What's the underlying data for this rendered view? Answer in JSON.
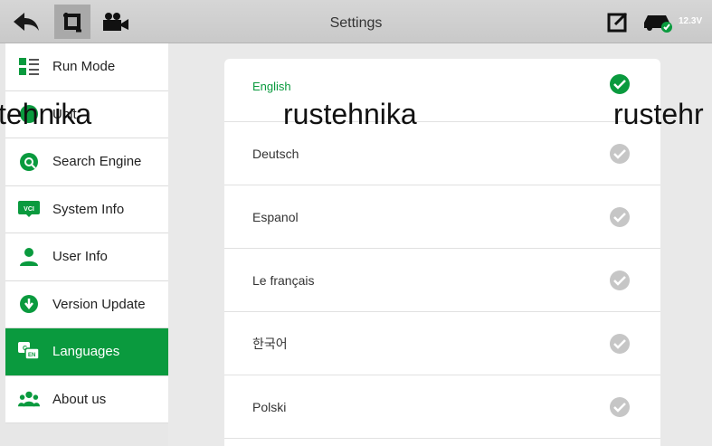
{
  "topbar": {
    "title": "Settings",
    "voltage": "12.3V"
  },
  "sidebar": {
    "items": [
      {
        "label": "Run Mode",
        "icon": "list-icon",
        "active": false
      },
      {
        "label": "Unit",
        "icon": "unit-icon",
        "active": false
      },
      {
        "label": "Search Engine",
        "icon": "search-engine-icon",
        "active": false
      },
      {
        "label": "System Info",
        "icon": "vci-icon",
        "active": false
      },
      {
        "label": "User Info",
        "icon": "user-icon",
        "active": false
      },
      {
        "label": "Version Update",
        "icon": "download-icon",
        "active": false
      },
      {
        "label": "Languages",
        "icon": "languages-icon",
        "active": true
      },
      {
        "label": "About us",
        "icon": "people-icon",
        "active": false
      }
    ]
  },
  "languages": {
    "items": [
      {
        "label": "English",
        "selected": true
      },
      {
        "label": "Deutsch",
        "selected": false
      },
      {
        "label": "Espanol",
        "selected": false
      },
      {
        "label": "Le français",
        "selected": false
      },
      {
        "label": "한국어",
        "selected": false
      },
      {
        "label": "Polski",
        "selected": false
      }
    ]
  },
  "watermark": {
    "left": "tehnika",
    "center": "rustehnika",
    "right": "rustehr"
  },
  "colors": {
    "accent": "#0a9a3e",
    "inactive_check": "#c6c6c6"
  }
}
